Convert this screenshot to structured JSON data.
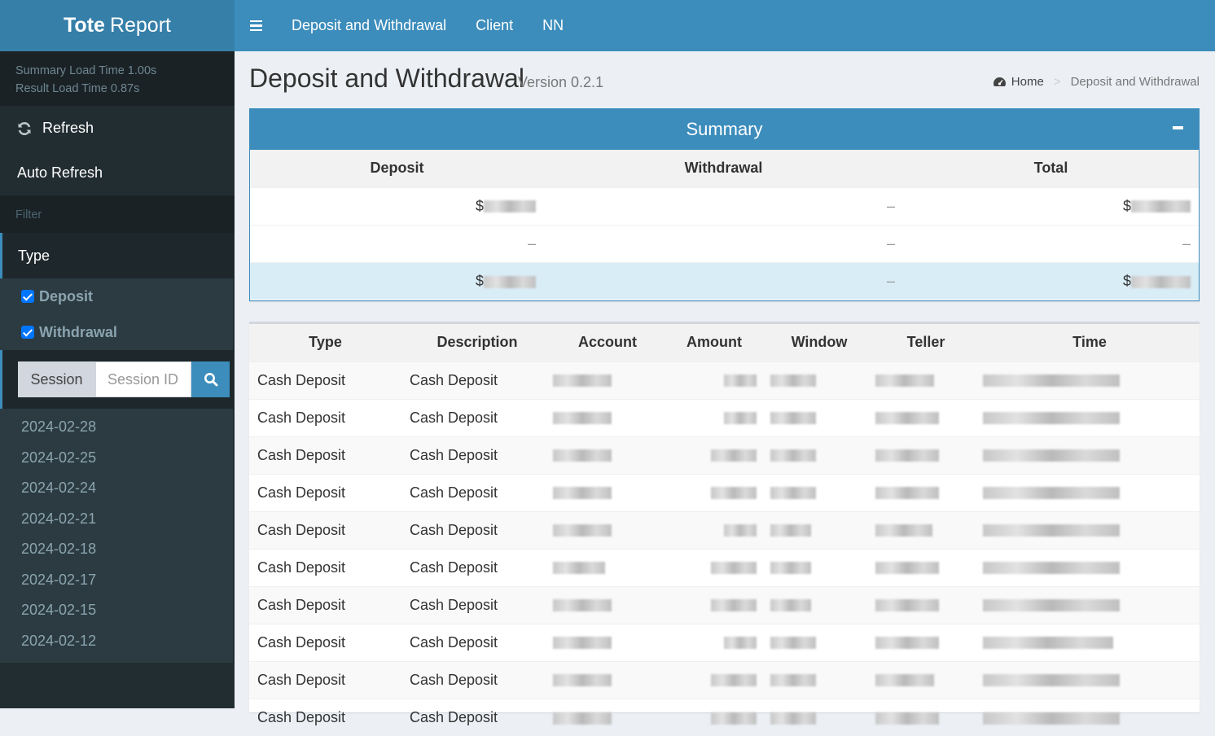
{
  "app": {
    "logo_bold": "Tote",
    "logo_light": "Report"
  },
  "topnav": {
    "links": [
      "Deposit and Withdrawal",
      "Client",
      "NN"
    ]
  },
  "sidebar": {
    "summary_load": "Summary Load Time 1.00s",
    "result_load": "Result Load Time 0.87s",
    "refresh": "Refresh",
    "auto_refresh": "Auto Refresh",
    "filter_header": "Filter",
    "type_label": "Type",
    "checkboxes": [
      {
        "label": "Deposit",
        "checked": true
      },
      {
        "label": "Withdrawal",
        "checked": true
      }
    ],
    "session_label": "Session",
    "session_placeholder": "Session ID",
    "dates": [
      "2024-02-28",
      "2024-02-25",
      "2024-02-24",
      "2024-02-21",
      "2024-02-18",
      "2024-02-17",
      "2024-02-15",
      "2024-02-12"
    ]
  },
  "page": {
    "title": "Deposit and Withdrawal",
    "version": "Version 0.2.1"
  },
  "breadcrumb": {
    "home": "Home",
    "current": "Deposit and Withdrawal"
  },
  "summary": {
    "title": "Summary",
    "headers": [
      "Deposit",
      "Withdrawal",
      "Total"
    ],
    "rows": [
      {
        "deposit": "$",
        "withdrawal": "–",
        "total": "$"
      },
      {
        "deposit": "–",
        "withdrawal": "–",
        "total": "–"
      },
      {
        "deposit": "$",
        "withdrawal": "–",
        "total": "$"
      }
    ]
  },
  "results": {
    "headers": [
      "Type",
      "Description",
      "Account",
      "Amount",
      "Window",
      "Teller",
      "Time"
    ],
    "rows": [
      {
        "type": "Cash Deposit",
        "description": "Cash Deposit"
      },
      {
        "type": "Cash Deposit",
        "description": "Cash Deposit"
      },
      {
        "type": "Cash Deposit",
        "description": "Cash Deposit"
      },
      {
        "type": "Cash Deposit",
        "description": "Cash Deposit"
      },
      {
        "type": "Cash Deposit",
        "description": "Cash Deposit"
      },
      {
        "type": "Cash Deposit",
        "description": "Cash Deposit"
      },
      {
        "type": "Cash Deposit",
        "description": "Cash Deposit"
      },
      {
        "type": "Cash Deposit",
        "description": "Cash Deposit"
      },
      {
        "type": "Cash Deposit",
        "description": "Cash Deposit"
      },
      {
        "type": "Cash Deposit",
        "description": "Cash Deposit"
      }
    ]
  },
  "colors": {
    "brand_dark": "#367fa9",
    "brand": "#3c8dbc",
    "sidebar": "#222d32",
    "highlight_row": "#d9edf7"
  },
  "icons": [
    "hamburger-icon",
    "refresh-icon",
    "search-icon",
    "dashboard-icon",
    "minus-icon"
  ]
}
